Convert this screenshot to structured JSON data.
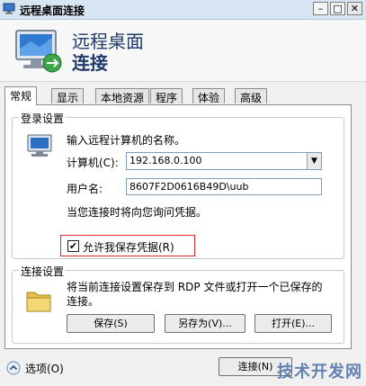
{
  "window": {
    "title": "远程桌面连接",
    "controls": {
      "minimize": "–",
      "maximize": "□",
      "close": "✕"
    }
  },
  "header": {
    "line1": "远程桌面",
    "line2": "连接",
    "icon": "remote-desktop-monitor-icon"
  },
  "tabs": [
    {
      "label": "常规",
      "active": true
    },
    {
      "label": "显示",
      "active": false
    },
    {
      "label": "本地资源",
      "active": false
    },
    {
      "label": "程序",
      "active": false
    },
    {
      "label": "体验",
      "active": false
    },
    {
      "label": "高级",
      "active": false
    }
  ],
  "login": {
    "group_title": "登录设置",
    "instruction": "输入远程计算机的名称。",
    "computer_label": "计算机(C):",
    "computer_value": "192.168.0.100",
    "username_label": "用户名:",
    "username_value": "8607F2D0616B49D\\uub",
    "prompt_text": "当您连接时将向您询问凭据。",
    "save_credentials_label": "允许我保存凭据(R)",
    "save_credentials_checked": true
  },
  "connection": {
    "group_title": "连接设置",
    "description": "将当前连接设置保存到 RDP 文件或打开一个已保存的连接。",
    "save_button": "保存(S)",
    "save_as_button": "另存为(V)...",
    "open_button": "打开(E)..."
  },
  "footer": {
    "options_label": "选项(O)",
    "connect_button": "连接(N)",
    "watermark": "技术开发网"
  },
  "colors": {
    "accent": "#1f3a6b",
    "highlight_border": "#e0262b",
    "panel_bg": "#ffffff"
  }
}
